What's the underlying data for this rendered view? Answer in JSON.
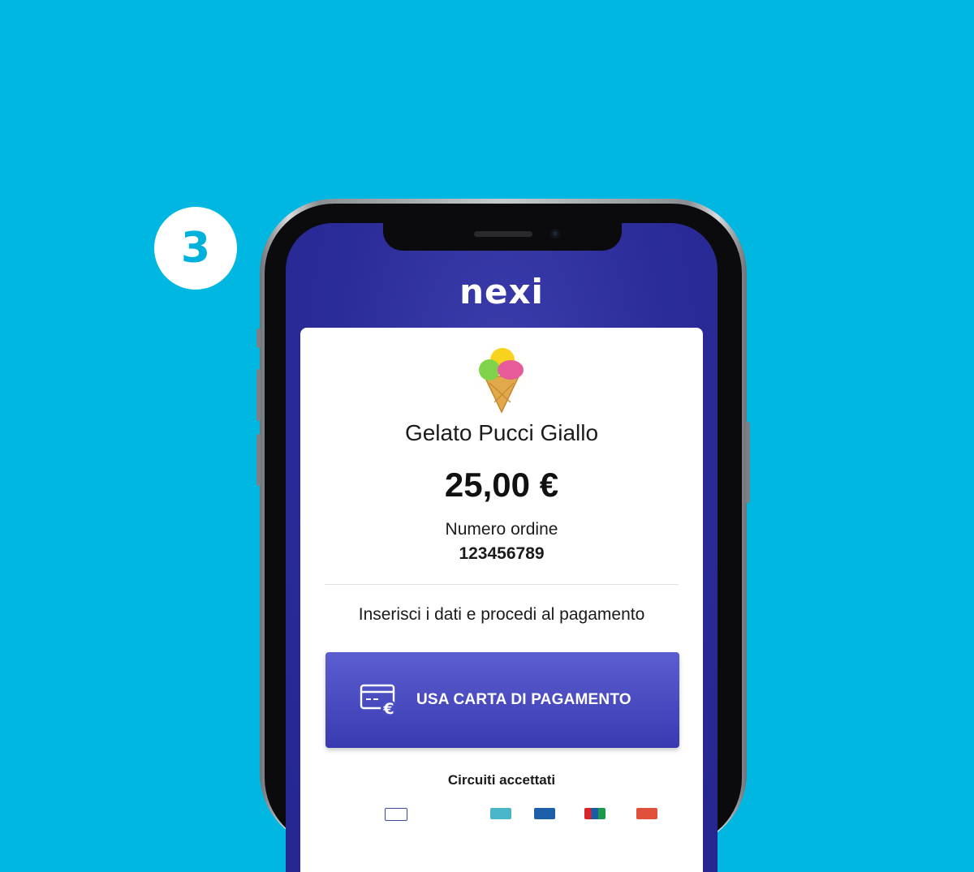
{
  "step": {
    "number": "3"
  },
  "app": {
    "logo": "nexi"
  },
  "product": {
    "icon": "ice-cream-cone-icon",
    "name": "Gelato Pucci Giallo",
    "amount": "25,00 €"
  },
  "order": {
    "label": "Numero ordine",
    "number": "123456789"
  },
  "instructions": "Inserisci i dati e procedi al pagamento",
  "pay_button": {
    "icon": "credit-card-euro-icon",
    "label": "USA CARTA DI PAGAMENTO"
  },
  "circuits": {
    "title": "Circuiti accettati",
    "logos": [
      "card-circuit-logo-1",
      "card-circuit-logo-2",
      "card-circuit-logo-3",
      "card-circuit-logo-4",
      "card-circuit-logo-5"
    ]
  },
  "colors": {
    "background": "#00b7e1",
    "screen": "#2b2c9a",
    "button": "#4a4cc4",
    "badge_text": "#00b1dc"
  }
}
